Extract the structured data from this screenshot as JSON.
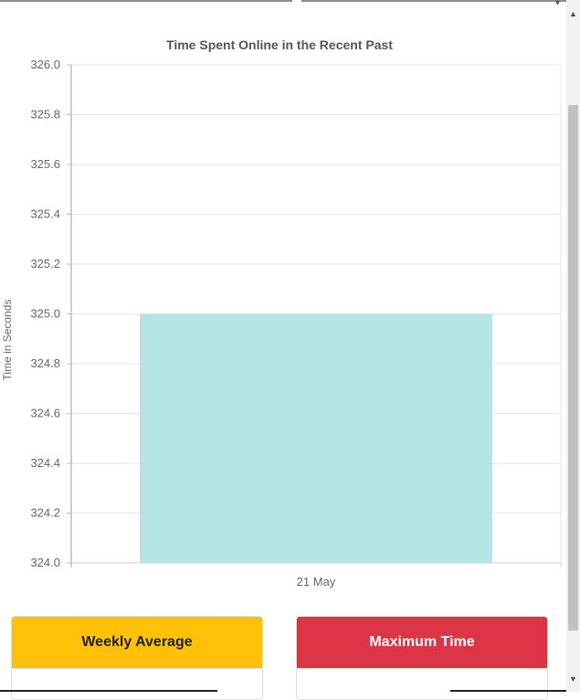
{
  "chart_data": {
    "type": "bar",
    "title": "Time Spent Online in the Recent Past",
    "ylabel": "Time in Seconds",
    "xlabel": "",
    "categories": [
      "21 May"
    ],
    "values": [
      325
    ],
    "ylim": [
      324.0,
      326.0
    ],
    "yticks": [
      "326.0",
      "325.8",
      "325.6",
      "325.4",
      "325.2",
      "325.0",
      "324.8",
      "324.6",
      "324.4",
      "324.2",
      "324.0"
    ],
    "bar_color": "#b4e4e4",
    "grid": true
  },
  "cards": {
    "weekly_average_label": "Weekly Average",
    "maximum_time_label": "Maximum Time"
  },
  "colors": {
    "weekly_average": "#ffc107",
    "maximum_time": "#dc3545"
  }
}
